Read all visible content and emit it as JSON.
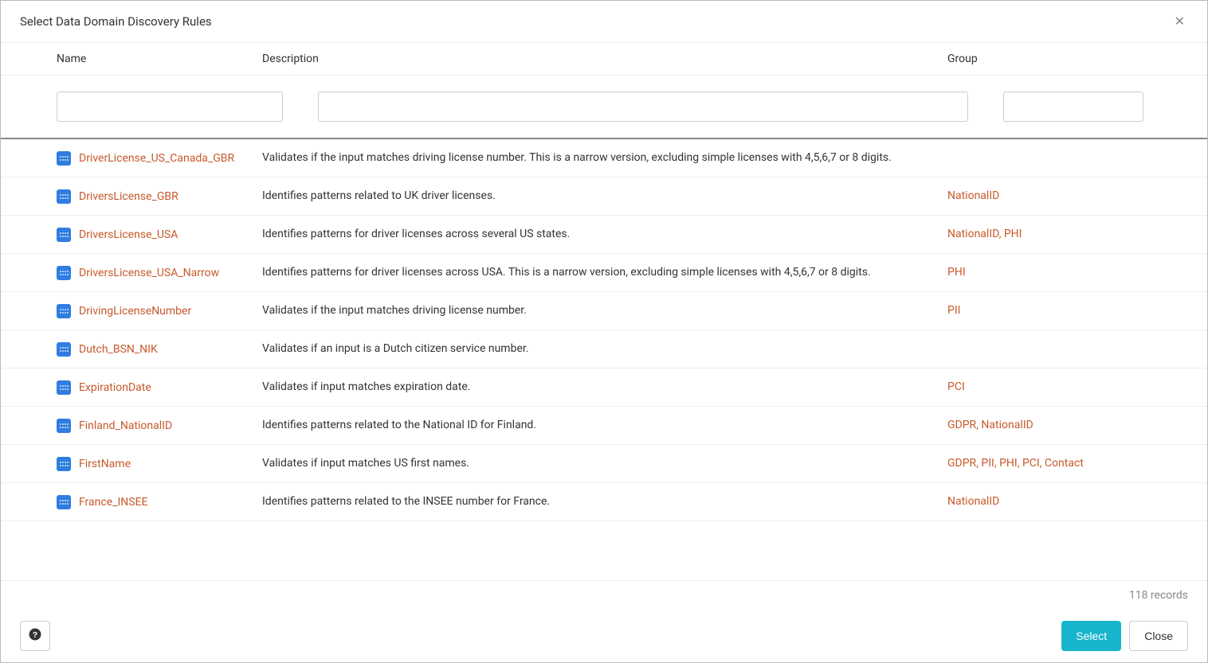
{
  "modal": {
    "title": "Select Data Domain Discovery Rules",
    "close_glyph": "✕"
  },
  "columns": {
    "name": "Name",
    "description": "Description",
    "group": "Group"
  },
  "filters": {
    "name_value": "",
    "desc_value": "",
    "group_value": ""
  },
  "rows": [
    {
      "name": "DriverLicense_US_Canada_GBR",
      "description": "Validates if the input matches driving license number. This is a narrow version, excluding simple licenses with 4,5,6,7 or 8 digits.",
      "group": ""
    },
    {
      "name": "DriversLicense_GBR",
      "description": "Identifies patterns related to UK driver licenses.",
      "group": "NationalID"
    },
    {
      "name": "DriversLicense_USA",
      "description": "Identifies patterns for driver licenses across several US states.",
      "group": "NationalID, PHI"
    },
    {
      "name": "DriversLicense_USA_Narrow",
      "description": "Identifies patterns for driver licenses across USA. This is a narrow version, excluding simple licenses with 4,5,6,7 or 8 digits.",
      "group": "PHI"
    },
    {
      "name": "DrivingLicenseNumber",
      "description": "Validates if the input matches driving license number.",
      "group": "PII"
    },
    {
      "name": "Dutch_BSN_NIK",
      "description": "Validates if an input is a Dutch citizen service number.",
      "group": ""
    },
    {
      "name": "ExpirationDate",
      "description": "Validates if input matches expiration date.",
      "group": "PCI"
    },
    {
      "name": "Finland_NationalID",
      "description": "Identifies patterns related to the National ID for Finland.",
      "group": "GDPR, NationalID"
    },
    {
      "name": "FirstName",
      "description": "Validates if input matches US first names.",
      "group": "GDPR, PII, PHI, PCI, Contact"
    },
    {
      "name": "France_INSEE",
      "description": "Identifies patterns related to the INSEE number for France.",
      "group": "NationalID"
    }
  ],
  "records_text": "118 records",
  "footer": {
    "select_label": "Select",
    "close_label": "Close"
  }
}
